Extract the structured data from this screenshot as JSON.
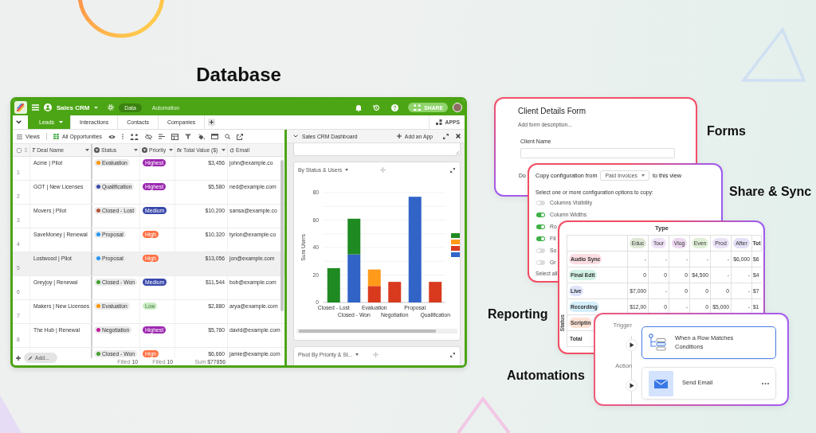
{
  "heading": "Database",
  "app": {
    "title": "Sales CRM",
    "modes": [
      {
        "label": "Data",
        "selected": true
      },
      {
        "label": "Automation",
        "selected": false
      }
    ],
    "share": "SHARE",
    "tabs": [
      {
        "label": "Leads",
        "selected": true
      },
      {
        "label": "Interactions",
        "selected": false
      },
      {
        "label": "Contacts",
        "selected": false
      },
      {
        "label": "Companies",
        "selected": false
      }
    ],
    "apps": "APPS",
    "toolbar": {
      "views": "Views",
      "view_name": "All Opportunities"
    },
    "table": {
      "columns": [
        {
          "kind": "glyph",
          "glyph": "T",
          "label": "Deal Name"
        },
        {
          "kind": "select",
          "label": "Status"
        },
        {
          "kind": "select",
          "label": "Priority"
        },
        {
          "kind": "glyph",
          "glyph": "fx",
          "label": "Total Value ($)"
        },
        {
          "kind": "lookup",
          "label": "Email"
        }
      ],
      "rows": [
        {
          "number": "1",
          "deal": "Acme | Pilot",
          "status": {
            "label": "Evaluation",
            "color": "#ff9800"
          },
          "priority": {
            "label": "Highest",
            "color": "#9c27b0"
          },
          "value": "$3,456",
          "email": "john@example.co",
          "selected": false
        },
        {
          "number": "2",
          "deal": "GOT | New Licenses",
          "status": {
            "label": "Qualification",
            "color": "#3949ab"
          },
          "priority": {
            "label": "Highest",
            "color": "#9c27b0"
          },
          "value": "$5,580",
          "email": "ned@example.com",
          "selected": false
        },
        {
          "number": "3",
          "deal": "Movers | Pilot",
          "status": {
            "label": "Closed - Lost",
            "color": "#b5533b"
          },
          "priority": {
            "label": "Medium",
            "color": "#3949ab"
          },
          "value": "$10,200",
          "email": "sansa@example.co",
          "selected": false
        },
        {
          "number": "4",
          "deal": "SaveMoney | Renewal",
          "status": {
            "label": "Proposal",
            "color": "#2196f3"
          },
          "priority": {
            "label": "High",
            "color": "#ff7043"
          },
          "value": "$10,320",
          "email": "tyrion@example.co",
          "selected": false
        },
        {
          "number": "5",
          "deal": "Lostwood | Pilot",
          "status": {
            "label": "Proposal",
            "color": "#2196f3"
          },
          "priority": {
            "label": "High",
            "color": "#ff7043"
          },
          "value": "$13,056",
          "email": "jon@example.com",
          "selected": true
        },
        {
          "number": "6",
          "deal": "Greyjoy | Renewal",
          "status": {
            "label": "Closed - Won",
            "color": "#43a02f"
          },
          "priority": {
            "label": "Medium",
            "color": "#3949ab"
          },
          "value": "$11,544",
          "email": "bob@example.com",
          "selected": false
        },
        {
          "number": "7",
          "deal": "Makers | New Licenses",
          "status": {
            "label": "Evaluation",
            "color": "#ff9800"
          },
          "priority": {
            "label": "Low",
            "color": "#cdeec6"
          },
          "value": "$2,880",
          "email": "arya@example.com",
          "selected": false
        },
        {
          "number": "8",
          "deal": "The Hub | Renewal",
          "status": {
            "label": "Negotiation",
            "color": "#c2189b"
          },
          "priority": {
            "label": "Highest",
            "color": "#9c27b0"
          },
          "value": "$5,760",
          "email": "david@example.com",
          "selected": false
        },
        {
          "status": {
            "label": "Closed - Won",
            "color": "#43a02f"
          },
          "priority": {
            "label": "High",
            "color": "#ff7043"
          },
          "value": "$6,660",
          "email": "jamie@example.com",
          "selected": false
        }
      ],
      "footer": [
        {
          "label": "Filled",
          "value": "10"
        },
        {
          "label": "Filled",
          "value": "10"
        },
        {
          "label": "Sum",
          "value": "$77856"
        }
      ],
      "add_button": "Add..."
    }
  },
  "dashboard": {
    "title": "Sales CRM Dashboard",
    "add_app": "Add an App",
    "chart_widget": {
      "title": "By Status & Users",
      "chart_data": {
        "type": "bar",
        "ylabel": "Sum Users",
        "categories": [
          "Closed - Lost",
          "Closed - Won",
          "Evaluation",
          "Negotiation",
          "Proposal",
          "Qualification"
        ],
        "series": [
          {
            "color": "#3264c8",
            "values": [
              null,
              35,
              null,
              null,
              77,
              null
            ]
          },
          {
            "color": "#d93a1e",
            "values": [
              null,
              null,
              12,
              15,
              null,
              15
            ]
          },
          {
            "color": "#ff9a1a",
            "values": [
              null,
              null,
              12,
              null,
              null,
              null
            ]
          },
          {
            "color": "#1f8a22",
            "values": [
              25,
              26,
              null,
              null,
              null,
              null
            ]
          }
        ],
        "ylim": [
          0,
          80
        ],
        "yticks": [
          0,
          20,
          40,
          60,
          80
        ],
        "stacked": true,
        "grid": true
      }
    },
    "pivot_widget": {
      "title": "Pivot By Priority & St..."
    }
  },
  "forms": {
    "label": "Forms",
    "title": "Client Details Form",
    "description": "Add form description...",
    "field_label": "Client Name",
    "next_label": "Do"
  },
  "share_sync": {
    "label": "Share & Sync",
    "prefix": "Copy configuration from",
    "source": "Paid Invoices",
    "suffix": "to this view",
    "prompt": "Select one or more configuration options to copy:",
    "options": [
      {
        "label": "Columns Visibility",
        "on": false
      },
      {
        "label": "Column Widths",
        "on": true
      },
      {
        "label": "Ro",
        "on": true
      },
      {
        "label": "Fil",
        "on": true
      },
      {
        "label": "So",
        "on": false
      },
      {
        "label": "Gr",
        "on": false
      }
    ],
    "select_all": "Select all"
  },
  "reporting": {
    "label": "Reporting",
    "column_group": "Type",
    "row_group": "Status",
    "columns": [
      {
        "label": "Educ",
        "color": "#dfe8d6"
      },
      {
        "label": "Tour",
        "color": "#efe3f7"
      },
      {
        "label": "Vlog",
        "color": "#ecd8ef"
      },
      {
        "label": "Even",
        "color": "#e0f0d8"
      },
      {
        "label": "Prod",
        "color": "#e9e1f6"
      },
      {
        "label": "After",
        "color": "#e4e0f7"
      },
      {
        "label": "Tot"
      }
    ],
    "rows": [
      {
        "kind": "tag",
        "label": "Audio Sync",
        "color": "#fbdde3",
        "cells": [
          "-",
          "-",
          "-",
          "-",
          "-",
          "$6,000",
          "$6"
        ]
      },
      {
        "kind": "tag",
        "label": "Final Edit",
        "color": "#d3f2e6",
        "cells": [
          "0",
          "0",
          "0",
          "$4,500",
          "-",
          "-",
          "$4"
        ]
      },
      {
        "kind": "tag",
        "label": "Live",
        "color": "#dfe3fb",
        "cells": [
          "$7,000",
          "-",
          "0",
          "0",
          "0",
          "-",
          "$7"
        ]
      },
      {
        "kind": "tag",
        "label": "Recording",
        "color": "#d3eefa",
        "cells": [
          "$12,00",
          "0",
          "-",
          "0",
          "$5,000",
          "-",
          "$1"
        ]
      },
      {
        "kind": "tag",
        "label": "Scriptin",
        "color": "#fde2d4"
      },
      {
        "kind": "total",
        "label": "Total"
      }
    ]
  },
  "automations": {
    "label": "Automations",
    "steps": [
      {
        "kind": "trigger",
        "label": "Trigger",
        "title": "When a Row Matches Conditions",
        "selected": true
      },
      {
        "kind": "action",
        "label": "Action",
        "title": "Send Email",
        "selected": false
      }
    ]
  }
}
